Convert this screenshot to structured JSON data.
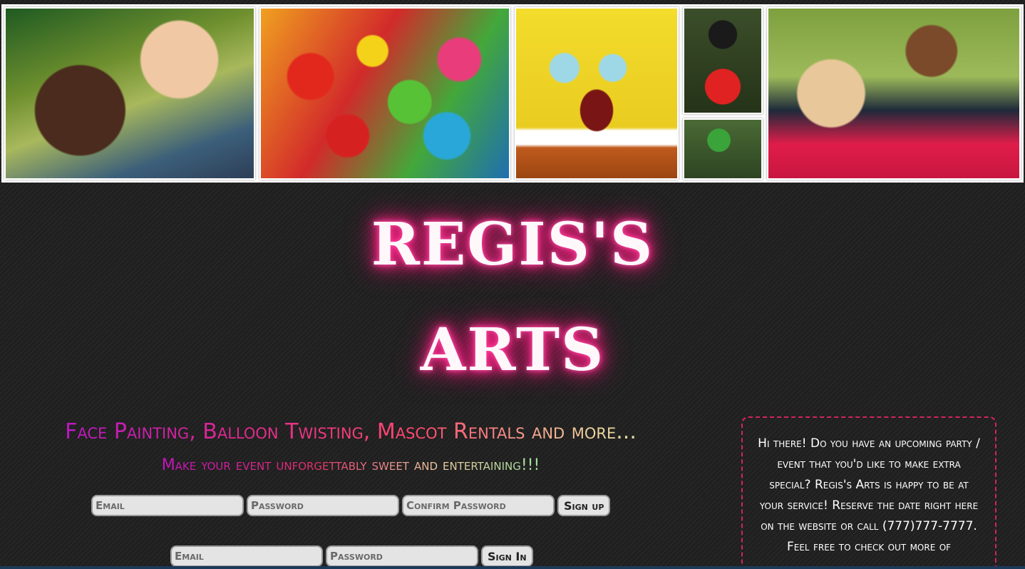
{
  "banner": {
    "photos": [
      "face-painting-photo",
      "balloon-animals-photo",
      "spongebob-mascot-photo",
      "mickey-mascot-photo",
      "ninja-turtle-mascot-photo",
      "artist-with-child-photo"
    ]
  },
  "title": {
    "line1": "REGIS'S",
    "line2": "ARTS",
    "glow_color": "#ff2f8f"
  },
  "tagline": "Face Painting, Balloon Twisting, Mascot Rentals and more...",
  "subtagline": "Make your event unforgettably sweet and entertaining!!!",
  "signup": {
    "email_placeholder": "Email",
    "password_placeholder": "Password",
    "confirm_placeholder": "Confirm Password",
    "button_label": "Sign up"
  },
  "signin": {
    "email_placeholder": "Email",
    "password_placeholder": "Password",
    "button_label": "Sign In"
  },
  "info_box": {
    "text": "Hi there! Do you have an upcoming party / event that you'd like to make extra special? Regis's Arts is happy to be at your service! Reserve the date right here on the website or call (777)777-7777. Feel free to check out more of",
    "border_color": "#d5235f"
  }
}
